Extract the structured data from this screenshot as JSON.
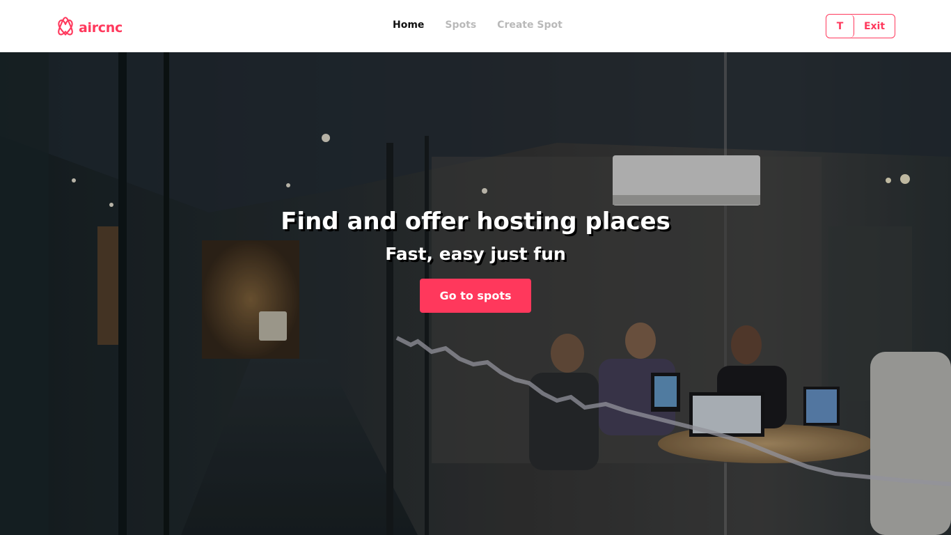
{
  "brand": {
    "name": "aircnc",
    "logo_icon": "airbnb-logo-icon",
    "color": "#ff385c"
  },
  "nav": {
    "items": [
      {
        "label": "Home",
        "active": true
      },
      {
        "label": "Spots",
        "active": false
      },
      {
        "label": "Create Spot",
        "active": false
      }
    ]
  },
  "user": {
    "initial": "T",
    "exit_label": "Exit"
  },
  "hero": {
    "title": "Find and offer hosting places",
    "subtitle": "Fast, easy just fun",
    "cta_label": "Go to spots",
    "cta_color": "#ff385c",
    "background": "dark office meeting room photo"
  }
}
